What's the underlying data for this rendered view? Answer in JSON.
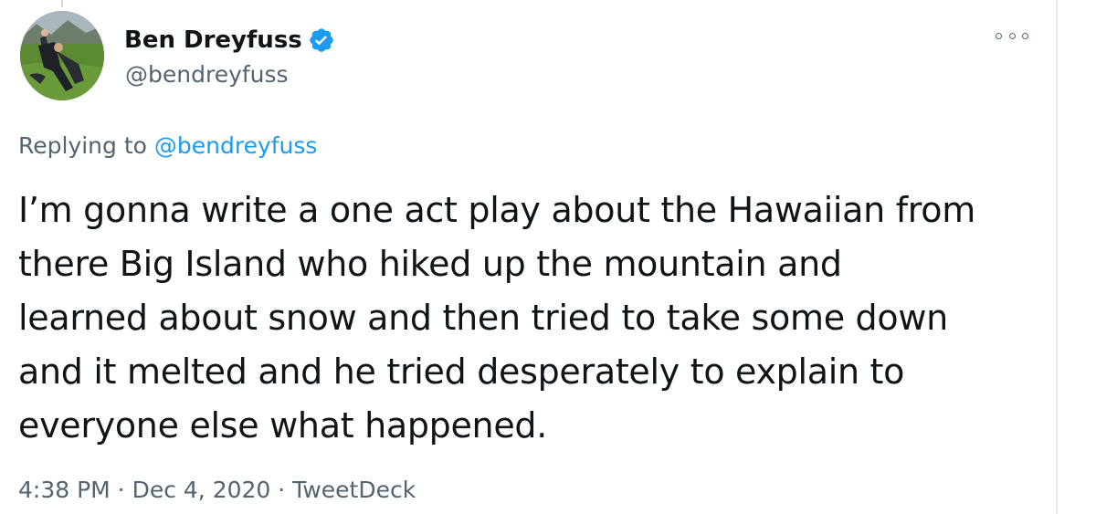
{
  "author": {
    "name": "Ben Dreyfuss",
    "handle": "@bendreyfuss",
    "verified": true
  },
  "reply": {
    "prefix": "Replying to ",
    "to_handle": "@bendreyfuss"
  },
  "tweet": {
    "lines": [
      "I’m gonna write a one act play about the Hawaiian from",
      "there Big Island who hiked up the mountain and",
      "learned about snow and then tried to take some down",
      "and it melted and he tried desperately to explain to",
      "everyone else what happened."
    ]
  },
  "meta": {
    "time": "4:38 PM",
    "separator": " · ",
    "date": "Dec 4, 2020",
    "source": "TweetDeck"
  },
  "icons": {
    "verified": "verified-badge-icon",
    "more": "more-options-icon"
  },
  "colors": {
    "link": "#1d9bf0",
    "secondary_text": "#536471",
    "primary_text": "#0f1419"
  }
}
